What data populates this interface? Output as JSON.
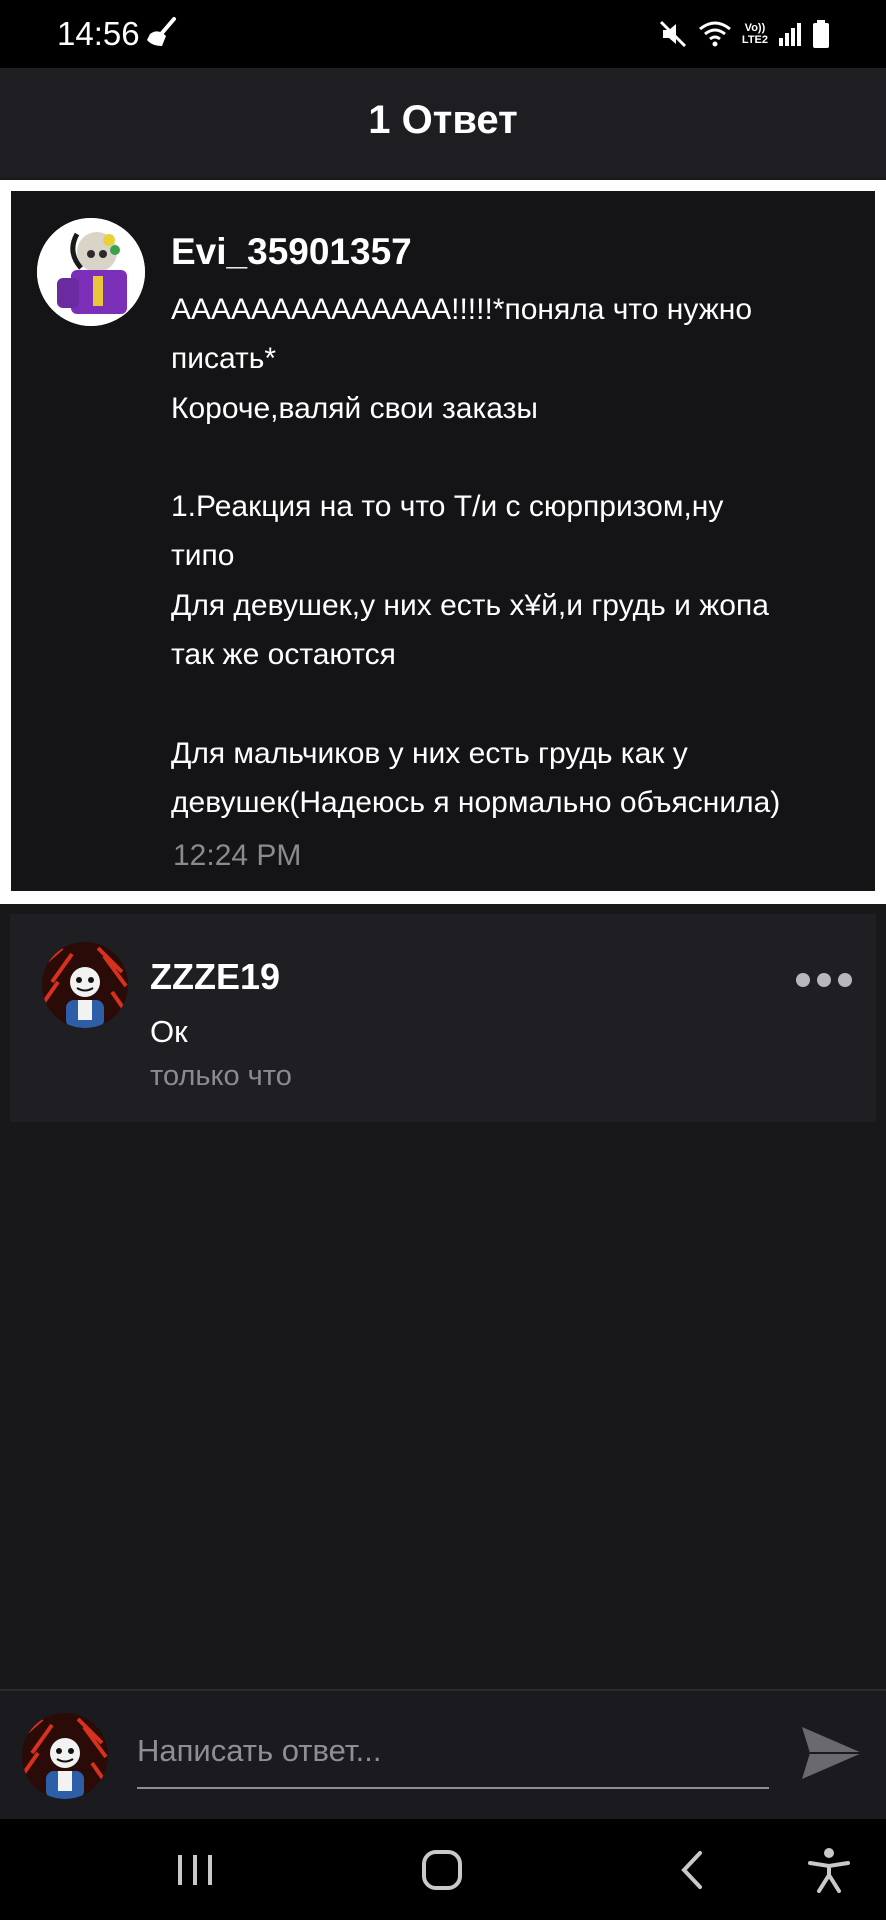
{
  "status_bar": {
    "time": "14:56",
    "lte_top": "Vo))",
    "lte_bottom": "LTE2",
    "icons": [
      "broom-icon",
      "mute-icon",
      "wifi-icon",
      "signal-icon",
      "battery-icon"
    ]
  },
  "header": {
    "title": "1 Ответ"
  },
  "post": {
    "author": "Evi_35901357",
    "lines": [
      "AAAAAAAAAAAAAA!!!!!*поняла что нужно",
      "писать*",
      "Короче,валяй свои заказы",
      "",
      "1.Реакция на то что Т/и с сюрпризом,ну",
      "типо",
      "Для девушек,у них есть х¥й,и грудь и жопа",
      "так же остаются",
      "",
      "Для мальчиков у них есть грудь как у",
      "девушек(Надеюсь я нормально объяснила)"
    ],
    "time": "12:24 PM"
  },
  "reply": {
    "author": "ZZZE19",
    "text": "Ок",
    "time": "только что"
  },
  "compose": {
    "placeholder": "Написать ответ..."
  },
  "colors": {
    "background": "#18171a",
    "header": "#1e1d21",
    "card": "#1f1e22",
    "highlight_border": "#ffffff",
    "muted_text": "#8b8a8f"
  },
  "nav_icons": [
    "recents-icon",
    "home-icon",
    "back-icon",
    "accessibility-icon"
  ]
}
